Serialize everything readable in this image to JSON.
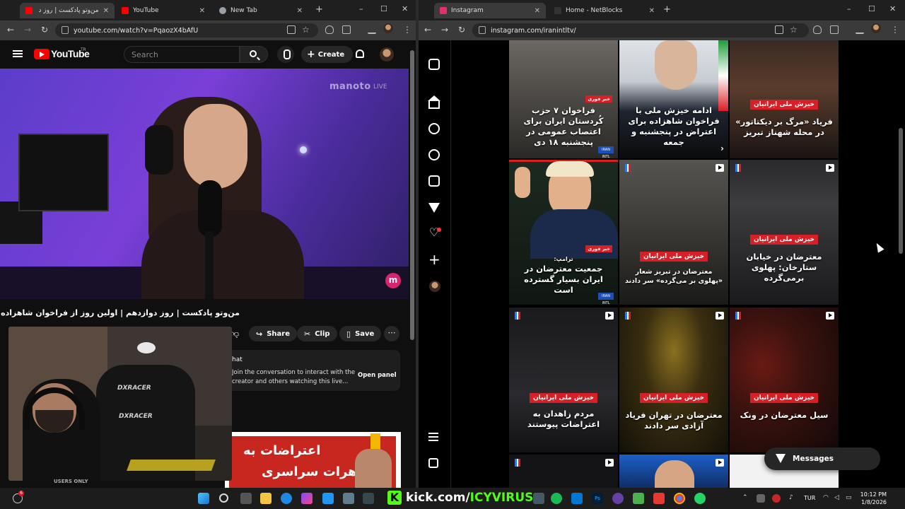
{
  "left_window": {
    "tabs": [
      {
        "label": "من‌وتو پادکست | روز د",
        "active": true,
        "favicon_color": "#ff0000"
      },
      {
        "label": "YouTube",
        "active": false,
        "favicon_color": "#ff0000"
      },
      {
        "label": "New Tab",
        "active": false,
        "favicon_color": "#9aa0a6"
      }
    ],
    "url": "youtube.com/watch?v=PqaozX4bAfU",
    "youtube": {
      "logo_text": "YouTube",
      "country_code": "TR",
      "search_placeholder": "Search",
      "create_label": "Create",
      "watermark": "manoto",
      "watermark_live": "LIVE",
      "channel_badge": "m",
      "video_title": "من‌وتو پادکست | روز دوازدهم | اولین روز از فراخوان شاهزاده رضا پهلوی",
      "share_label": "Share",
      "clip_label": "Clip",
      "save_label": "Save",
      "chat": {
        "title": "hat",
        "description": "Join the conversation to interact with the creator and others watching this live...",
        "open_label": "Open panel"
      },
      "ad": {
        "line1": "اعتراضات به",
        "line2": "تظاهرات سراسری"
      },
      "webcam": {
        "chair_brand": "DXRACER",
        "chair_brand2": "DXRACER",
        "users_only": "USERS ONLY"
      }
    }
  },
  "right_window": {
    "tabs": [
      {
        "label": "Instagram",
        "active": true,
        "favicon_color": "#e1306c"
      },
      {
        "label": "Home - NetBlocks",
        "active": false,
        "favicon_color": "#333333"
      }
    ],
    "url": "instagram.com/iranintltv/",
    "instagram": {
      "posts": [
        {
          "tag": "خبر فوری",
          "caption": "فراخوان ۷ حزب کُردستان ایران برای اعتصاب عمومی در پنجشنبه ۱۸ دی",
          "badge": "IRAN INTL"
        },
        {
          "tag": "",
          "caption": "ادامه خیزش ملی با فراخوان شاهزاده برای اعتراض در پنجشنبه و جمعه"
        },
        {
          "tag": "خیزش ملی ایرانیان",
          "caption": "فریاد «مرگ بر دیکتاتور» در محله شهناز تبریز"
        },
        {
          "tag": "خبر فوری",
          "subtitle": "ترامپ:",
          "caption": "جمعیت معترضان در ایران بسیار گسترده است",
          "badge": "IRAN INTL"
        },
        {
          "tag": "خیزش ملی ایرانیان",
          "caption": "معترضان در تبریز شعار «پهلوی بر می‌گرده» سر دادند"
        },
        {
          "tag": "خیزش ملی ایرانیان",
          "caption": "معترضان در خیابان ستارخان: پهلوی برمی‌گرده"
        },
        {
          "tag": "خیزش ملی ایرانیان",
          "caption": "مردم زاهدان به اعتراضات پیوستند"
        },
        {
          "tag": "خیزش ملی ایرانیان",
          "caption": "معترضان در تهران فریاد آزادی سر دادند"
        },
        {
          "tag": "خیزش ملی ایرانیان",
          "caption": "سیل معترضان در ونک"
        }
      ],
      "messages_label": "Messages"
    }
  },
  "taskbar": {
    "kick_prefix": "kick.com/",
    "kick_channel": "ICYVIRUS",
    "lang": "TUR",
    "time": "10:12 PM",
    "date": "1/8/2026",
    "notification_count": "6"
  },
  "colors": {
    "youtube_red": "#ff0000",
    "instagram_tag_red": "#d81f26",
    "kick_green": "#53fc18"
  }
}
